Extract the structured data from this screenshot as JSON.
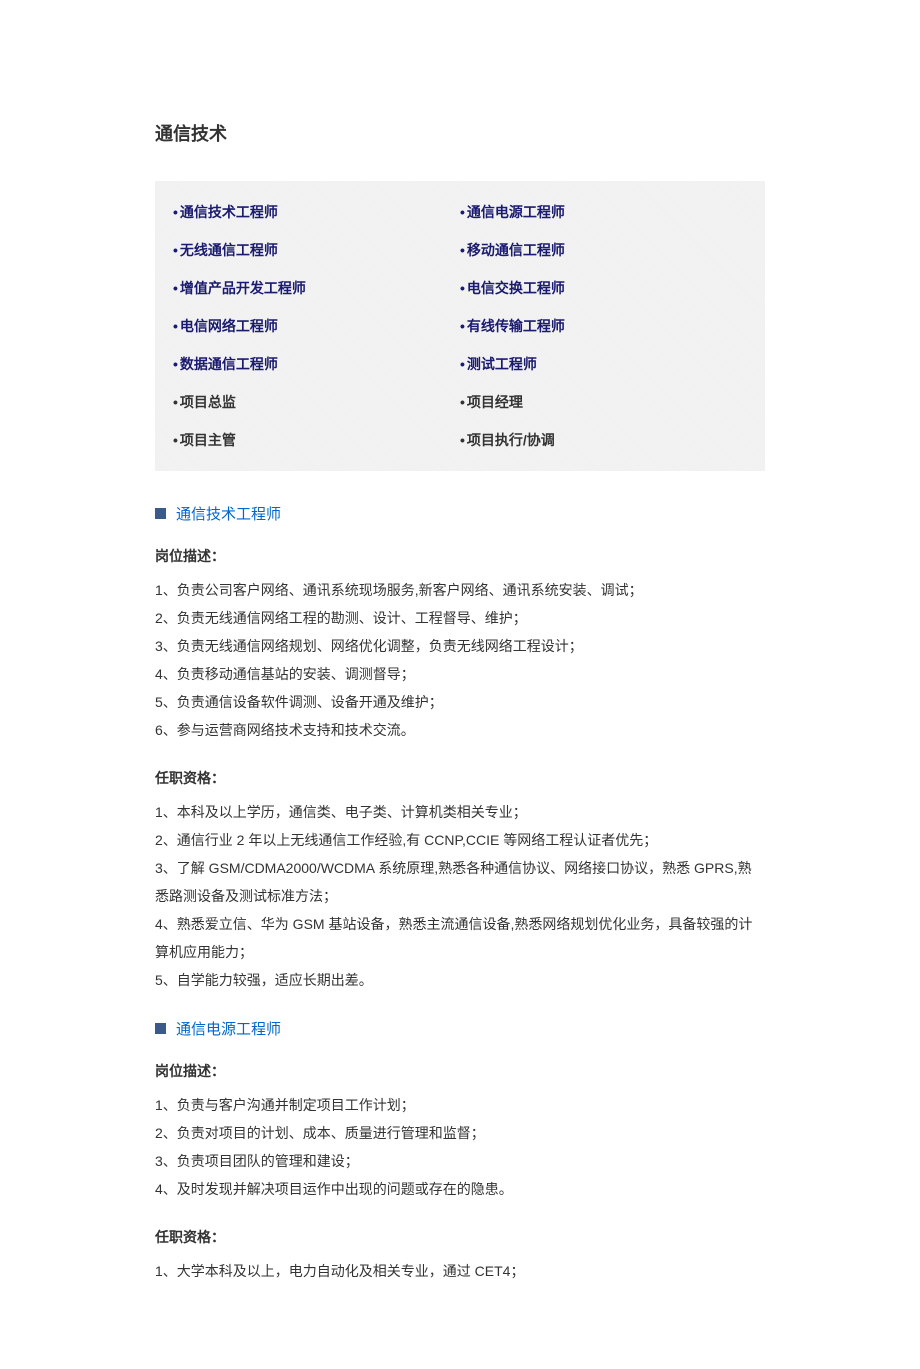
{
  "title": "通信技术",
  "jobTable": [
    {
      "left": "通信技术工程师",
      "right": "通信电源工程师",
      "linked": true
    },
    {
      "left": "无线通信工程师",
      "right": "移动通信工程师",
      "linked": true
    },
    {
      "left": "增值产品开发工程师",
      "right": "电信交换工程师",
      "linked": true
    },
    {
      "left": "电信网络工程师",
      "right": "有线传输工程师",
      "linked": true
    },
    {
      "left": "数据通信工程师",
      "right": "测试工程师",
      "linked": true
    },
    {
      "left": "项目总监",
      "right": "项目经理",
      "linked": false
    },
    {
      "left": "项目主管",
      "right": "项目执行/协调",
      "linked": false
    }
  ],
  "sections": [
    {
      "title": "通信技术工程师",
      "blocks": [
        {
          "heading": "岗位描述：",
          "lines": [
            "1、负责公司客户网络、通讯系统现场服务,新客户网络、通讯系统安装、调试；",
            "2、负责无线通信网络工程的勘测、设计、工程督导、维护；",
            "3、负责无线通信网络规划、网络优化调整，负责无线网络工程设计；",
            "4、负责移动通信基站的安装、调测督导；",
            "5、负责通信设备软件调测、设备开通及维护；",
            "6、参与运营商网络技术支持和技术交流。"
          ]
        },
        {
          "heading": "任职资格：",
          "lines": [
            "1、本科及以上学历，通信类、电子类、计算机类相关专业；",
            "2、通信行业 2 年以上无线通信工作经验,有 CCNP,CCIE 等网络工程认证者优先；",
            "3、了解 GSM/CDMA2000/WCDMA 系统原理,熟悉各种通信协议、网络接口协议，熟悉 GPRS,熟悉路测设备及测试标准方法；",
            "4、熟悉爱立信、华为 GSM 基站设备，熟悉主流通信设备,熟悉网络规划优化业务，具备较强的计算机应用能力；",
            "5、自学能力较强，适应长期出差。"
          ]
        }
      ]
    },
    {
      "title": "通信电源工程师",
      "blocks": [
        {
          "heading": "岗位描述：",
          "lines": [
            "1、负责与客户沟通并制定项目工作计划；",
            "2、负责对项目的计划、成本、质量进行管理和监督；",
            "3、负责项目团队的管理和建设；",
            "4、及时发现并解决项目运作中出现的问题或存在的隐患。"
          ]
        },
        {
          "heading": "任职资格：",
          "lines": [
            "1、大学本科及以上，电力自动化及相关专业，通过 CET4；"
          ]
        }
      ]
    }
  ]
}
